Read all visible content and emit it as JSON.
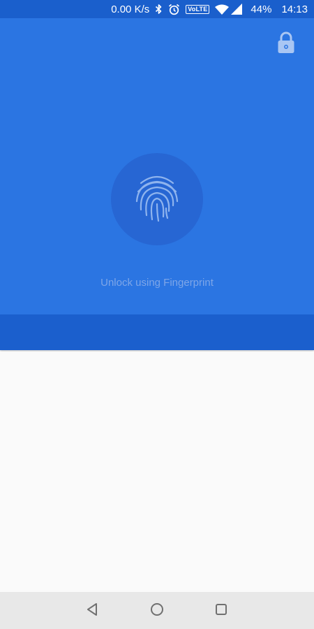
{
  "status_bar": {
    "net_speed": "0.00 K/s",
    "volte": "VoLTE",
    "battery": "44%",
    "time": "14:13",
    "icons": [
      "bluetooth-icon",
      "alarm-icon",
      "wifi-icon",
      "signal-icon",
      "battery-icon"
    ]
  },
  "lock_screen": {
    "message": "Unlock using Fingerprint",
    "icons": [
      "lock-icon",
      "fingerprint-icon"
    ]
  },
  "nav_bar": {
    "icons": [
      "back-icon",
      "home-icon",
      "recents-icon"
    ]
  },
  "colors": {
    "status_bar": "#1a5fcc",
    "hero": "#2b75e2",
    "app_bar": "#1b5fcd",
    "content": "#fafafa",
    "nav_bar": "#e8e8e8"
  }
}
